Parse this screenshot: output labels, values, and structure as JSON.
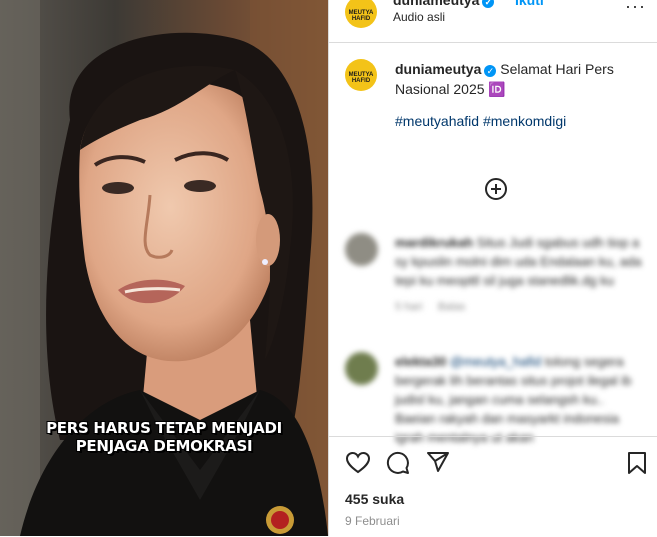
{
  "post": {
    "username": "duniameutya",
    "follow_label": "Ikuti",
    "audio_label": "Audio asli",
    "more_label": "···",
    "avatar_text": "MEUTYA HAFID",
    "caption_text": "Selamat Hari Pers Nasional 2025 🆔",
    "hashtags": [
      "#meutyahafid",
      "#menkomdigi"
    ],
    "likes": "455 suka",
    "date": "9 Februari"
  },
  "media": {
    "overlay_line1": "PERS HARUS TETAP MENJADI",
    "overlay_line2": "PENJAGA DEMOKRASI"
  },
  "comments": [
    {
      "username": "mardikrukah",
      "text": "Situs Judi sgabus udh tiop a sy kpuslin molni dim uda Endalaan ku, ada tepi ku meopttl sil juga stanedlik.dg ku",
      "time": "5 hari",
      "reply": "Balas"
    },
    {
      "username": "elekta30",
      "mention": "@meutya_hafid",
      "text": "tolong segera bergerak lih berantas situs projot ilegal ib judisl ku, jangan cuma selangsh ku.. Baeian rakyah dan masyarkt indonesia igrah mentalnya ut akan",
      "time": "",
      "reply": ""
    }
  ],
  "icons": {
    "like": "heart-icon",
    "comment": "comment-icon",
    "share": "share-icon",
    "save": "bookmark-icon",
    "add": "plus-circle-icon"
  },
  "colors": {
    "accent": "#0095f6",
    "link": "#00376b",
    "avatar_yellow": "#f3c318",
    "muted": "#8e8e8e"
  }
}
